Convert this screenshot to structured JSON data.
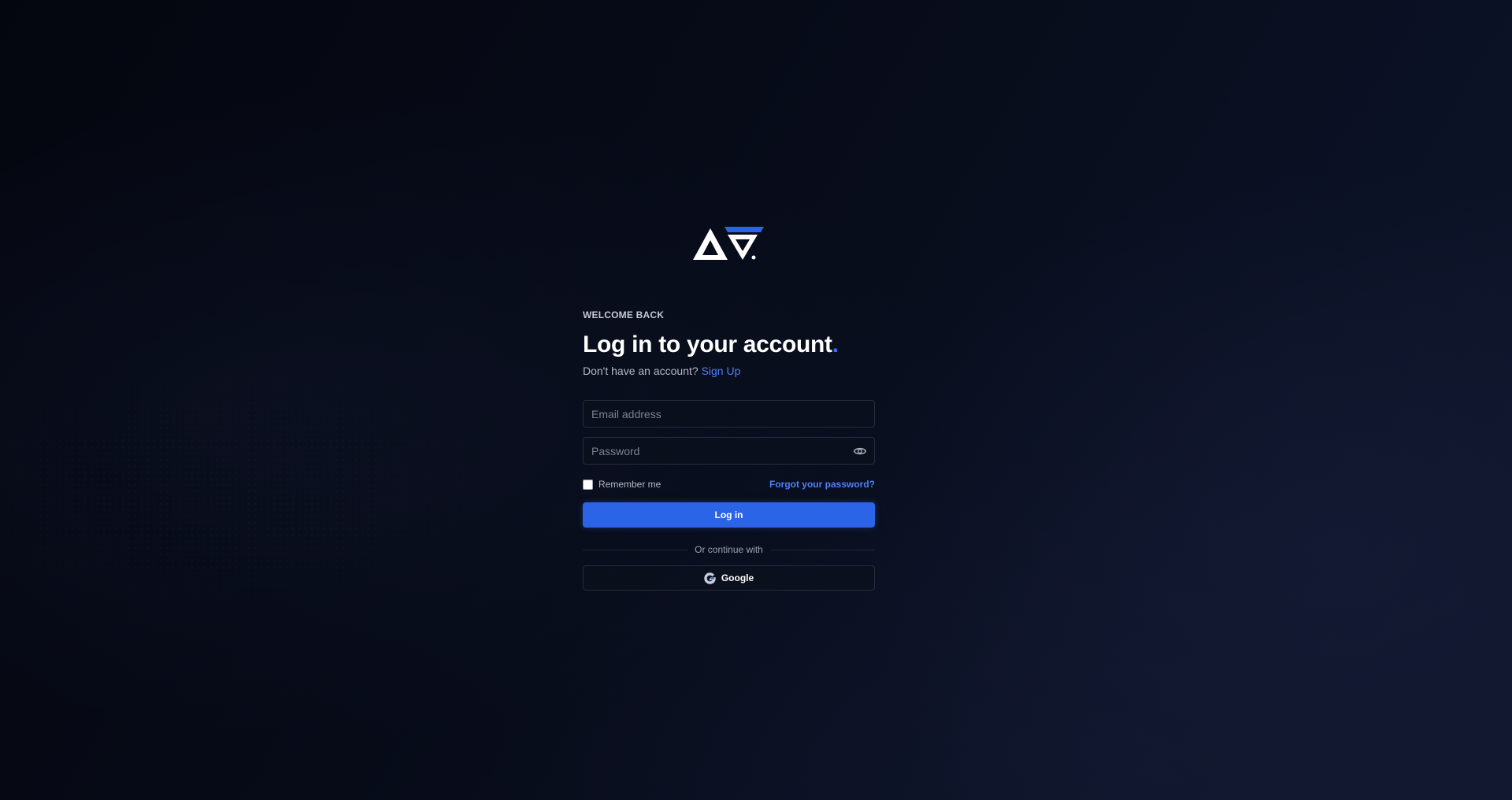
{
  "brand": {
    "logo_icon": "ag-logo-icon",
    "accent_color": "#3b6cf6"
  },
  "login": {
    "eyebrow": "WELCOME BACK",
    "title": "Log in to your account",
    "title_dot": ".",
    "no_account_text": "Don't have an account?",
    "signup_link": "Sign Up",
    "email_placeholder": "Email address",
    "password_placeholder": "Password",
    "password_toggle_icon": "eye-icon",
    "remember_label": "Remember me",
    "remember_checked": false,
    "forgot_link": "Forgot your password?",
    "submit_label": "Log in",
    "divider_text": "Or continue with",
    "google_label": "Google",
    "google_icon": "google-icon"
  }
}
